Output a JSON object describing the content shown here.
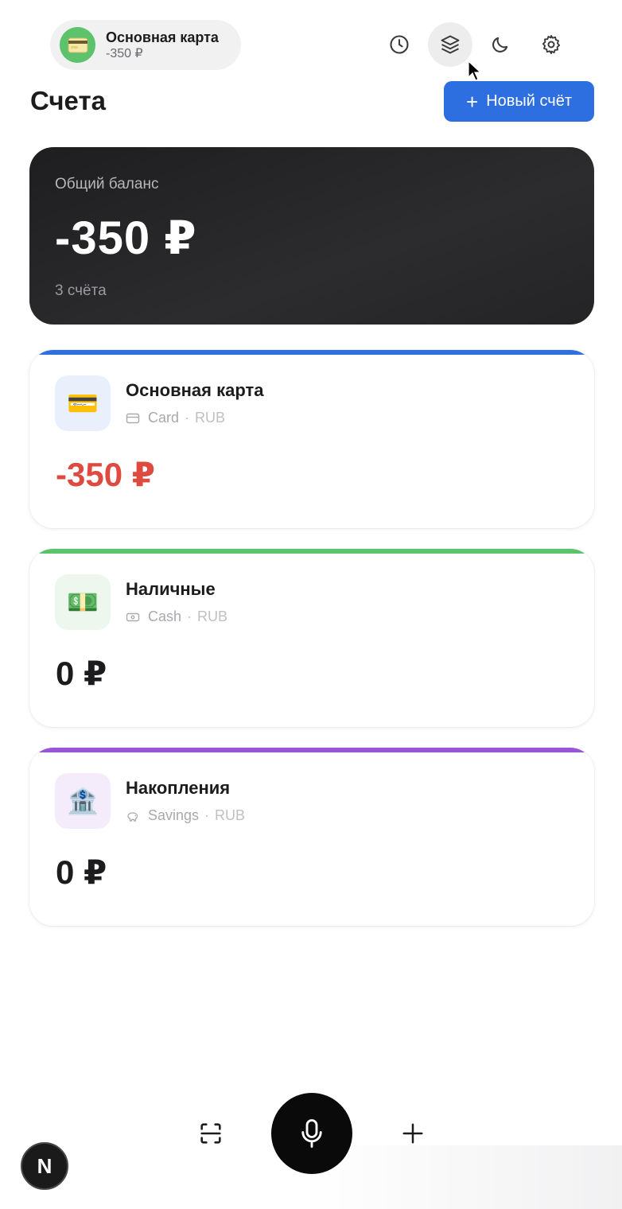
{
  "header": {
    "account_pill": {
      "name": "Основная карта",
      "balance": "-350 ₽",
      "icon": "credit-card-emoji"
    },
    "icons": [
      "clock-icon",
      "layers-icon",
      "moon-icon",
      "gear-icon"
    ],
    "active_icon": "layers-icon"
  },
  "page": {
    "title": "Счета",
    "new_account_label": "Новый счёт"
  },
  "balance_card": {
    "label": "Общий баланс",
    "amount": "-350 ₽",
    "count": "3 счёта"
  },
  "accounts": [
    {
      "name": "Основная карта",
      "type": "Card",
      "currency": "RUB",
      "amount": "-350 ₽",
      "icon": "💳",
      "stripe_color": "#2f6fde",
      "icon_bg": "#eaf0fb",
      "negative": true
    },
    {
      "name": "Наличные",
      "type": "Cash",
      "currency": "RUB",
      "amount": "0 ₽",
      "icon": "💵",
      "stripe_color": "#5cc26b",
      "icon_bg": "#edf7ee",
      "negative": false
    },
    {
      "name": "Накопления",
      "type": "Savings",
      "currency": "RUB",
      "amount": "0 ₽",
      "icon": "🏦",
      "stripe_color": "#9a55d6",
      "icon_bg": "#f4ecfb",
      "negative": false
    }
  ],
  "bottom_bar": {
    "left_icon": "scan-icon",
    "center_icon": "microphone-icon",
    "right_icon": "plus-icon",
    "dev_badge": "N"
  },
  "colors": {
    "accent": "#2d6fe0",
    "negative": "#de4a3f",
    "dark_card": "#1e1e20"
  }
}
